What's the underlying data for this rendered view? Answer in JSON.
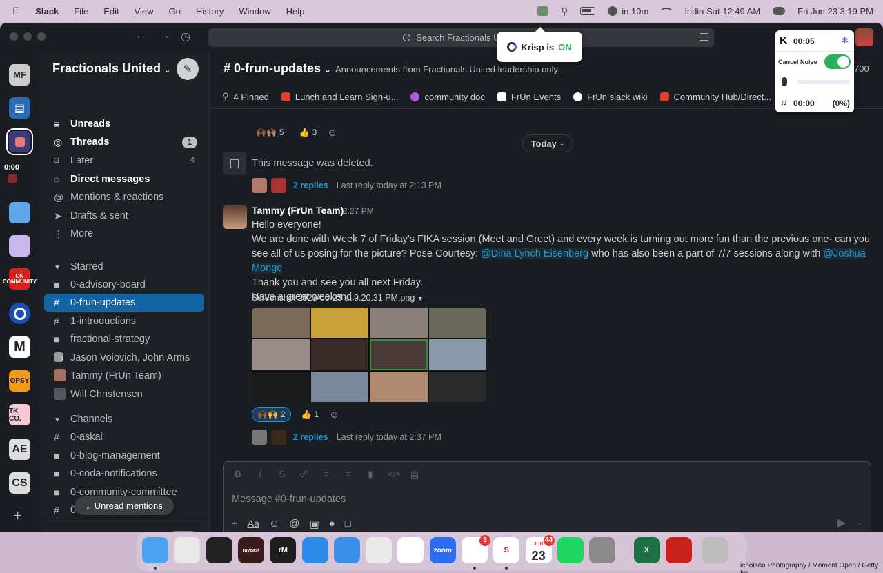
{
  "menubar": {
    "app": "Slack",
    "items": [
      "File",
      "Edit",
      "View",
      "Go",
      "History",
      "Window",
      "Help"
    ],
    "event": "in 10m",
    "clock_local": "India Sat 12:49 AM",
    "clock_main": "Fri Jun 23  3:19 PM"
  },
  "search": {
    "placeholder": "Search Fractionals United"
  },
  "krisp": {
    "toast_prefix": "Krisp is",
    "toast_state": "ON",
    "timer": "00:05",
    "cancel_noise": "Cancel Noise",
    "speaker_time": "00:00",
    "speaker_pct": "(0%)"
  },
  "rail": {
    "timer": "0:00",
    "workspaces": [
      "MF",
      "ON COMMUNITY",
      "M",
      "OPSY",
      "TK CO.",
      "AE",
      "CS"
    ]
  },
  "sidebar": {
    "workspace": "Fractionals United",
    "nav": [
      {
        "label": "Unreads",
        "icon": "≡",
        "bold": true
      },
      {
        "label": "Threads",
        "icon": "◎",
        "bold": true,
        "badge": "1"
      },
      {
        "label": "Later",
        "icon": "⌑",
        "count": "4"
      },
      {
        "label": "Direct messages",
        "icon": "◌",
        "bold": true
      },
      {
        "label": "Mentions & reactions",
        "icon": "@"
      },
      {
        "label": "Drafts & sent",
        "icon": "➤"
      },
      {
        "label": "More",
        "icon": "⋮"
      }
    ],
    "starred_header": "Starred",
    "starred": [
      {
        "label": "0-advisory-board",
        "icon": "🔒"
      },
      {
        "label": "0-frun-updates",
        "icon": "#",
        "active": true
      },
      {
        "label": "1-introductions",
        "icon": "#"
      },
      {
        "label": "fractional-strategy",
        "icon": "🔒"
      },
      {
        "label": "Jason Voiovich, John Arms",
        "icon": "2"
      },
      {
        "label": "Tammy (FrUn Team)",
        "icon": "av"
      },
      {
        "label": "Will Christensen",
        "icon": "av"
      }
    ],
    "channels_header": "Channels",
    "channels": [
      {
        "label": "0-askai",
        "icon": "#"
      },
      {
        "label": "0-blog-management",
        "icon": "🔒"
      },
      {
        "label": "0-coda-notifications",
        "icon": "🔒"
      },
      {
        "label": "0-community-committee",
        "icon": "🔒"
      },
      {
        "label": "0-",
        "icon": "#"
      }
    ],
    "unread_mentions": "Unread mentions",
    "footer_channel": "0-frun-updates"
  },
  "channel": {
    "name": "0-frun-updates",
    "description": "Announcements from Fractionals United leadership only.",
    "member_count": "700",
    "tabs": [
      {
        "label": "4 Pinned",
        "color": "#1a1d21",
        "icon": "pin"
      },
      {
        "label": "Lunch and Learn Sign-u...",
        "color": "#e03e2f"
      },
      {
        "label": "community doc",
        "color": "#a95ee0"
      },
      {
        "label": "FrUn Events",
        "color": "#ffffff"
      },
      {
        "label": "FrUn slack wiki",
        "color": "#1a1d21"
      },
      {
        "label": "Community Hub/Direct...",
        "color": "#e03e2f"
      }
    ]
  },
  "messages": {
    "top_reactions": [
      {
        "emoji": "🙌🏾🙌🏽",
        "count": "5"
      },
      {
        "emoji": "👍",
        "count": "3"
      }
    ],
    "date_divider": "Today",
    "deleted_text": "This message was deleted.",
    "deleted_thread": {
      "replies": "2 replies",
      "last": "Last reply today at 2:13 PM"
    },
    "post": {
      "author": "Tammy (FrUn Team)",
      "time": "2:27 PM",
      "line1": "Hello everyone!",
      "line2a": "We are done with Week 7 of Friday's FIKA session (Meet and Greet) and every week is turning out more fun than the previous one- can you see all of us posing for the picture? Pose Courtesy: ",
      "mention1": "@Dina Lynch Eisenberg",
      "line2b": " who has also been a part of  7/7 sessions along with ",
      "mention2": "@Joshua Monge",
      "line3": "Thank you and see you all next Friday.",
      "line4": "Have a great weekend.",
      "file": "Screenshot 2023-06-23 at 9.20.31 PM.png",
      "reactions": [
        {
          "emoji": "🙌🏾🙌",
          "count": "2",
          "on": true
        },
        {
          "emoji": "👍",
          "count": "1"
        }
      ],
      "thread": {
        "replies": "2 replies",
        "last": "Last reply today at 2:37 PM"
      }
    }
  },
  "composer": {
    "placeholder": "Message #0-frun-updates"
  },
  "dock": {
    "apps": [
      {
        "name": "finder",
        "label": "",
        "color": "#4aa3f0"
      },
      {
        "name": "launchpad",
        "label": "",
        "color": "#e8e8e8"
      },
      {
        "name": "alfred",
        "label": "",
        "color": "#222222"
      },
      {
        "name": "raycast",
        "label": "raycast",
        "color": "#3a1a1a"
      },
      {
        "name": "remarkable",
        "label": "rM",
        "color": "#1e1e1e"
      },
      {
        "name": "icloud",
        "label": "",
        "color": "#2d8ae6"
      },
      {
        "name": "safari",
        "label": "",
        "color": "#3a90e8"
      },
      {
        "name": "chrome",
        "label": "",
        "color": "#e9e9e9"
      },
      {
        "name": "clickup",
        "label": "",
        "color": "#ffffff"
      },
      {
        "name": "zoom",
        "label": "zoom",
        "color": "#2d6cf0"
      },
      {
        "name": "slack",
        "label": "",
        "color": "#ffffff",
        "badge": "3"
      },
      {
        "name": "superhuman",
        "label": "S",
        "color": "#ffffff"
      },
      {
        "name": "calendar",
        "label": "23",
        "color": "#ffffff",
        "badge": "44",
        "sub": "JUN"
      },
      {
        "name": "spotify",
        "label": "",
        "color": "#1ed760"
      },
      {
        "name": "settings",
        "label": "",
        "color": "#8a8a8a"
      },
      {
        "name": "excel",
        "label": "X",
        "color": "#1d7044"
      },
      {
        "name": "acrobat",
        "label": "",
        "color": "#c9201d"
      },
      {
        "name": "trash",
        "label": "",
        "color": "#bdbdbd"
      }
    ]
  },
  "credit": "icholson Photography / Moment Open / Getty Im"
}
